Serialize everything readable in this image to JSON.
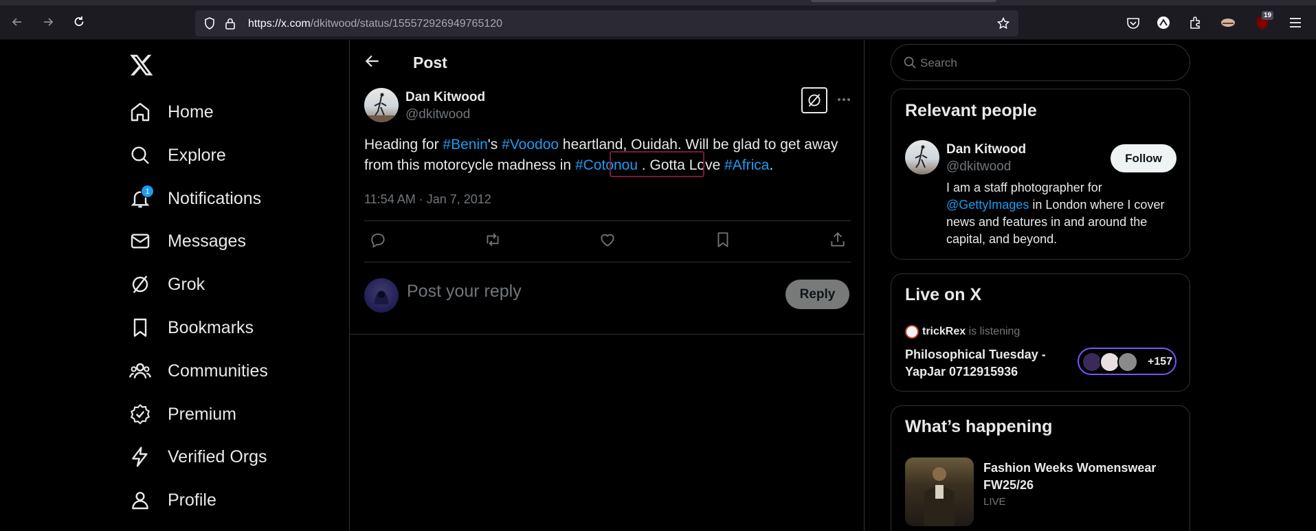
{
  "browser": {
    "url_host": "https://x.com",
    "url_path": "/dkitwood/status/155572926949765120",
    "extension_badge_count": "19"
  },
  "left_nav": {
    "items": [
      {
        "label": "Home",
        "icon": "home-icon"
      },
      {
        "label": "Explore",
        "icon": "search-icon"
      },
      {
        "label": "Notifications",
        "icon": "bell-icon",
        "badge": "1"
      },
      {
        "label": "Messages",
        "icon": "envelope-icon"
      },
      {
        "label": "Grok",
        "icon": "grok-icon"
      },
      {
        "label": "Bookmarks",
        "icon": "bookmark-icon"
      },
      {
        "label": "Communities",
        "icon": "communities-icon"
      },
      {
        "label": "Premium",
        "icon": "verified-badge-icon"
      },
      {
        "label": "Verified Orgs",
        "icon": "lightning-icon"
      },
      {
        "label": "Profile",
        "icon": "person-icon"
      }
    ]
  },
  "post": {
    "heading": "Post",
    "author_name": "Dan Kitwood",
    "author_handle": "@dkitwood",
    "text_parts": {
      "p1": "Heading for ",
      "h1": "#Benin",
      "p2": "'s ",
      "h2": "#Voodoo",
      "p3": " heartland, Ouidah. Will be glad to get away from this motorcycle madness in ",
      "h3": "#Cotonou",
      "p4": " . Gotta Love ",
      "h4": "#Africa",
      "p5": "."
    },
    "timestamp": "11:54 AM · Jan 7, 2012",
    "reply_placeholder": "Post your reply",
    "reply_button": "Reply"
  },
  "right": {
    "search_placeholder": "Search",
    "relevant_people": {
      "title": "Relevant people",
      "name": "Dan Kitwood",
      "handle": "@dkitwood",
      "follow_label": "Follow",
      "bio_pre": "I am a staff photographer for ",
      "bio_mention": "@GettyImages",
      "bio_post": " in London where I cover news and features in and around the capital, and beyond."
    },
    "live": {
      "title": "Live on X",
      "host": "trickRex",
      "host_status": "is listening",
      "space_title": "Philosophical Tuesday - YapJar 0712915936",
      "listener_count": "+157"
    },
    "happening": {
      "title": "What’s happening",
      "trend_title": "Fashion Weeks Womenswear FW25/26",
      "trend_status": "LIVE"
    }
  },
  "colors": {
    "accent": "#1d9bf0",
    "background": "#000000",
    "border": "#2f3336",
    "muted_text": "#71767b",
    "highlight_box": "#7a1a3a",
    "live_pill": "#7856ff"
  }
}
